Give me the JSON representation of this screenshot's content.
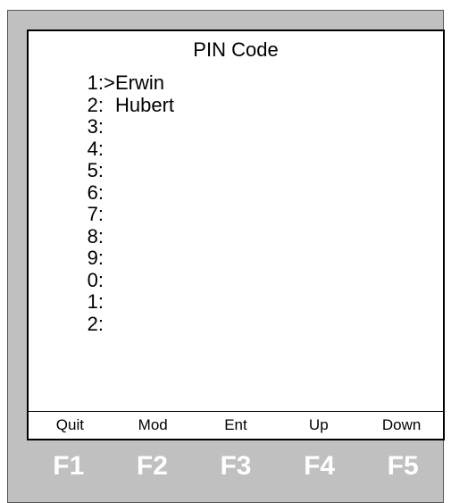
{
  "screen": {
    "title": "PIN Code",
    "cursor_symbol": ">",
    "entries": [
      {
        "index": "1:",
        "selected": true,
        "name": "Erwin"
      },
      {
        "index": "2:",
        "selected": false,
        "name": "Hubert"
      },
      {
        "index": "3:",
        "selected": false,
        "name": ""
      },
      {
        "index": "4:",
        "selected": false,
        "name": ""
      },
      {
        "index": "5:",
        "selected": false,
        "name": ""
      },
      {
        "index": "6:",
        "selected": false,
        "name": ""
      },
      {
        "index": "7:",
        "selected": false,
        "name": ""
      },
      {
        "index": "8:",
        "selected": false,
        "name": ""
      },
      {
        "index": "9:",
        "selected": false,
        "name": ""
      },
      {
        "index": "0:",
        "selected": false,
        "name": ""
      },
      {
        "index": "1:",
        "selected": false,
        "name": ""
      },
      {
        "index": "2:",
        "selected": false,
        "name": ""
      }
    ],
    "softkeys": [
      "Quit",
      "Mod",
      "Ent",
      "Up",
      "Down"
    ]
  },
  "function_keys": [
    "F1",
    "F2",
    "F3",
    "F4",
    "F5"
  ],
  "colors": {
    "device_body": "#c0c0c0",
    "screen_bg": "#ffffff",
    "key_text": "#ffffff"
  }
}
